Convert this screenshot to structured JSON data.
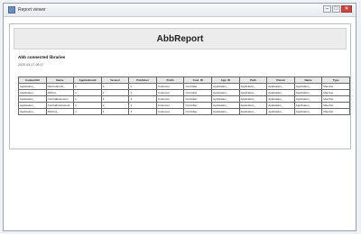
{
  "window": {
    "title": "Report viewer",
    "minimize": "–",
    "maximize": "□",
    "close": "✕"
  },
  "report": {
    "banner_title": "AbbReport",
    "section_title": "Abb connected libraries",
    "date": "2020-03-17 08:17"
  },
  "table": {
    "columns": [
      "CodeunitId",
      "Name",
      "ApplicationId",
      "Version",
      "Publisher",
      "Prefix",
      "Cust. ID",
      "App. ID",
      "Path",
      "Parent",
      "Name",
      "Type"
    ],
    "rows": [
      [
        "Application_",
        "NavCodeunit_",
        "1",
        "1",
        "1",
        "Customer",
        "Controller",
        "Application_",
        "Application_",
        "Application_",
        "Application_",
        "Member"
      ],
      [
        "Application_",
        "AbbCu_",
        "1",
        "1",
        "1",
        "Customer",
        "Controller",
        "Application_",
        "Application_",
        "Application_",
        "Application_",
        "Member"
      ],
      [
        "Application_",
        "ControlExtension",
        "1",
        "1",
        "1",
        "Customer",
        "Controller",
        "Application_",
        "Application_",
        "Application_",
        "Application_",
        "Member"
      ],
      [
        "Application_",
        "ControlFramework",
        "1",
        "1",
        "1",
        "Customer",
        "Controller",
        "Application_",
        "Application_",
        "Application_",
        "Application_",
        "Member"
      ],
      [
        "Application_",
        "AbbCus_",
        "1",
        "1",
        "1",
        "Customer",
        "Controller",
        "Application_",
        "Application_",
        "Application_",
        "Application_",
        "Member"
      ]
    ]
  }
}
